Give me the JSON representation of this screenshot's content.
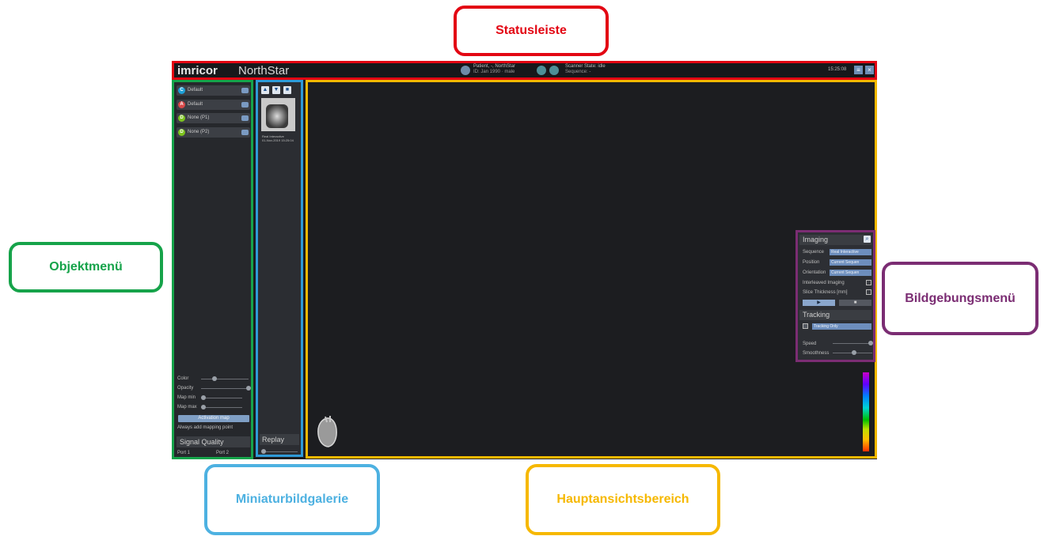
{
  "callouts": {
    "statusbar": "Statusleiste",
    "object_menu": "Objektmenü",
    "imaging_menu": "Bildgebungsmenü",
    "gallery": "Miniaturbildgalerie",
    "main_view": "Hauptansichtsbereich"
  },
  "statusbar": {
    "logo": "imricor",
    "product": "NorthStar",
    "patient_name": "Patient, -, NorthStar",
    "patient_id": "ID: Jan 1990 · male",
    "scanner_state": "Scanner State: idle",
    "scanner_sequence": "Sequence: -",
    "clock": "15:25:08"
  },
  "object_menu": {
    "items": [
      {
        "label": "Default",
        "icon": "C",
        "color": "#1e9fd6"
      },
      {
        "label": "Default",
        "icon": "A",
        "color": "#d94a4a"
      },
      {
        "label": "None (P1)",
        "icon": "D",
        "color": "#7cc31e"
      },
      {
        "label": "None (P2)",
        "icon": "D",
        "color": "#7cc31e"
      }
    ],
    "sliders": {
      "color": "Color",
      "opacity": "Opacity",
      "map_min": "Map min",
      "map_max": "Map max"
    },
    "activation_map": "Activation map",
    "always_add": "Always add mapping point",
    "signal_quality": "Signal Quality",
    "port1": "Port 1",
    "port2": "Port 2"
  },
  "gallery": {
    "thumb_caption1": "Real Interactive",
    "thumb_caption2": "01-Nov-2019 15:25:04",
    "replay": "Replay"
  },
  "imaging_menu": {
    "title": "Imaging",
    "sequence_label": "Sequence",
    "sequence_value": "Real Interactive",
    "position_label": "Position",
    "position_value": "Current Sequen",
    "orientation_label": "Orientation",
    "orientation_value": "Current Sequen",
    "interleaved": "Interleaved Imaging",
    "slice_thickness": "Slice Thickness [mm]",
    "tracking_title": "Tracking",
    "tracking_value": "Tracking Only",
    "speed": "Speed",
    "smoothness": "Smoothness"
  }
}
